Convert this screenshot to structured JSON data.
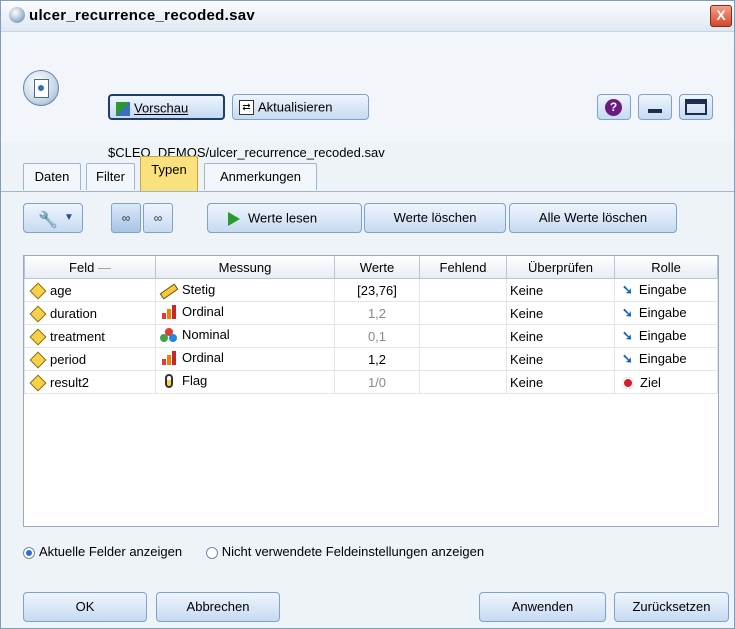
{
  "window": {
    "title": "ulcer_recurrence_recoded.sav",
    "close_label": "X"
  },
  "header": {
    "preview_label": "Vorschau",
    "refresh_label": "Aktualisieren",
    "help_label": "?",
    "file_path": "$CLEO_DEMOS/ulcer_recurrence_recoded.sav"
  },
  "tabs": [
    "Daten",
    "Filter",
    "Typen",
    "Anmerkungen"
  ],
  "active_tab": "Typen",
  "toolbar": {
    "read_values": "Werte lesen",
    "clear_values": "Werte löschen",
    "clear_all_values": "Alle Werte löschen"
  },
  "table": {
    "columns": [
      "Feld",
      "Messung",
      "Werte",
      "Fehlend",
      "Überprüfen",
      "Rolle"
    ],
    "rows": [
      {
        "field": "age",
        "measure": "Stetig",
        "measure_icon": "continuous-ruler-icon",
        "values": "[23,76]",
        "values_faded": false,
        "missing": "",
        "check": "Keine",
        "role": "Eingabe",
        "role_icon": "input-arrow-icon"
      },
      {
        "field": "duration",
        "measure": "Ordinal",
        "measure_icon": "ordinal-bars-icon",
        "values": "1,2",
        "values_faded": true,
        "missing": "",
        "check": "Keine",
        "role": "Eingabe",
        "role_icon": "input-arrow-icon"
      },
      {
        "field": "treatment",
        "measure": "Nominal",
        "measure_icon": "nominal-dots-icon",
        "values": "0,1",
        "values_faded": true,
        "missing": "",
        "check": "Keine",
        "role": "Eingabe",
        "role_icon": "input-arrow-icon"
      },
      {
        "field": "period",
        "measure": "Ordinal",
        "measure_icon": "ordinal-bars-icon",
        "values": "1,2",
        "values_faded": false,
        "missing": "",
        "check": "Keine",
        "role": "Eingabe",
        "role_icon": "input-arrow-icon"
      },
      {
        "field": "result2",
        "measure": "Flag",
        "measure_icon": "flag-icon",
        "values": "1/0",
        "values_faded": true,
        "missing": "",
        "check": "Keine",
        "role": "Ziel",
        "role_icon": "target-icon"
      }
    ]
  },
  "options": {
    "show_current": "Aktuelle Felder anzeigen",
    "show_unused": "Nicht verwendete Feldeinstellungen anzeigen",
    "selected": "show_current"
  },
  "footer": {
    "ok": "OK",
    "cancel": "Abbrechen",
    "apply": "Anwenden",
    "reset": "Zurücksetzen"
  },
  "colors": {
    "active_tab": "#f9e27d",
    "accent": "#2e6fc9"
  }
}
